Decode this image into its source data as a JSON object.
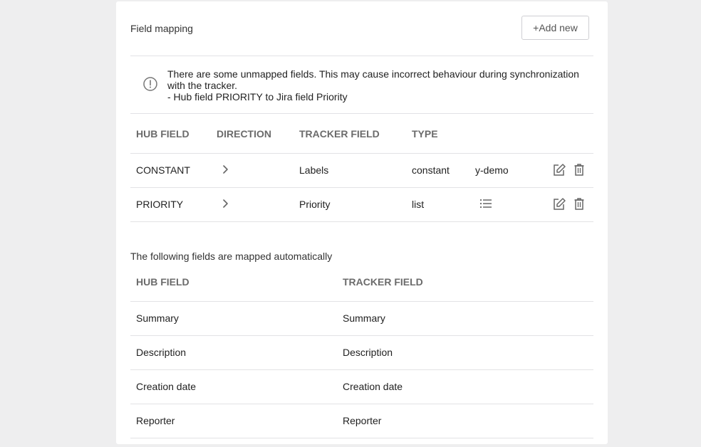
{
  "field_mapping": {
    "title": "Field mapping",
    "add_button_label": "+Add new",
    "warning": {
      "icon": "exclamation-circle-icon",
      "line1": "There are some unmapped fields. This may cause incorrect behaviour during synchronization with the tracker.",
      "line2": "- Hub field PRIORITY to Jira field Priority"
    },
    "columns": {
      "hub_field": "HUB FIELD",
      "direction": "DIRECTION",
      "tracker_field": "TRACKER FIELD",
      "type": "TYPE"
    },
    "rows": [
      {
        "hub_field": "CONSTANT",
        "direction_icon": "chevron-right-icon",
        "tracker_field": "Labels",
        "type": "constant",
        "value": "y-demo",
        "actions": [
          "edit-icon",
          "trash-icon"
        ]
      },
      {
        "hub_field": "PRIORITY",
        "direction_icon": "chevron-right-icon",
        "tracker_field": "Priority",
        "type": "list",
        "value_icon": "list-icon",
        "actions": [
          "edit-icon",
          "trash-icon"
        ]
      }
    ]
  },
  "auto_mapped": {
    "title": "The following fields are mapped automatically",
    "columns": {
      "hub_field": "HUB FIELD",
      "tracker_field": "TRACKER FIELD"
    },
    "rows": [
      {
        "hub_field": "Summary",
        "tracker_field": "Summary"
      },
      {
        "hub_field": "Description",
        "tracker_field": "Description"
      },
      {
        "hub_field": "Creation date",
        "tracker_field": "Creation date"
      },
      {
        "hub_field": "Reporter",
        "tracker_field": "Reporter"
      }
    ]
  },
  "colors": {
    "page_bg": "#eeeeef",
    "panel_bg": "#ffffff",
    "divider": "#e2e2e5",
    "header_text": "#6b6b6b",
    "icon": "#666666"
  }
}
